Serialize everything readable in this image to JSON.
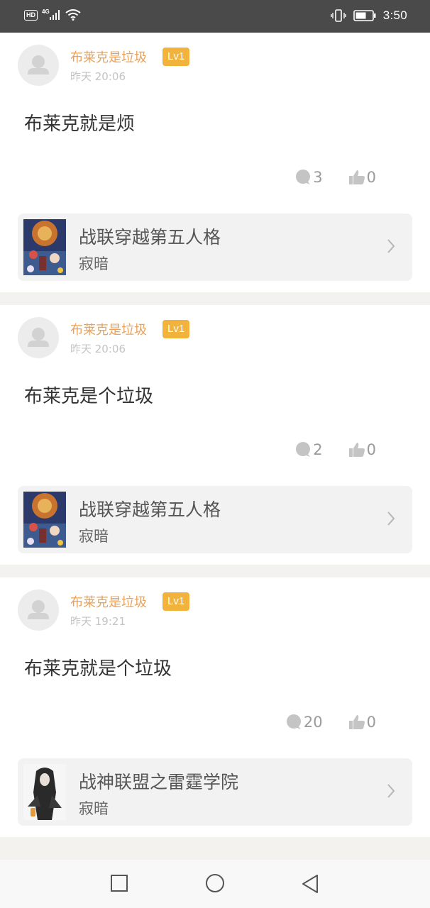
{
  "status_bar": {
    "hd": "HD",
    "network": "4G",
    "time": "3:50"
  },
  "colors": {
    "username": "#e9a25b",
    "level_badge": "#f2b33d",
    "status_bar_bg": "#4a4a4a"
  },
  "posts": [
    {
      "username": "布莱克是垃圾",
      "level": "Lv1",
      "time": "昨天 20:06",
      "content": "布莱克就是烦",
      "comments": "3",
      "likes": "0",
      "book": {
        "title": "战联穿越第五人格",
        "author": "寂暗",
        "cover_icon": "colorful-anime-cover"
      }
    },
    {
      "username": "布莱克是垃圾",
      "level": "Lv1",
      "time": "昨天 20:06",
      "content": "布莱克是个垃圾",
      "comments": "2",
      "likes": "0",
      "book": {
        "title": "战联穿越第五人格",
        "author": "寂暗",
        "cover_icon": "colorful-anime-cover"
      }
    },
    {
      "username": "布莱克是垃圾",
      "level": "Lv1",
      "time": "昨天 19:21",
      "content": "布莱克就是个垃圾",
      "comments": "20",
      "likes": "0",
      "book": {
        "title": "战神联盟之雷霆学院",
        "author": "寂暗",
        "cover_icon": "dark-character-cover"
      }
    }
  ],
  "nav": {
    "recent_icon": "square-icon",
    "home_icon": "circle-icon",
    "back_icon": "triangle-back-icon"
  }
}
